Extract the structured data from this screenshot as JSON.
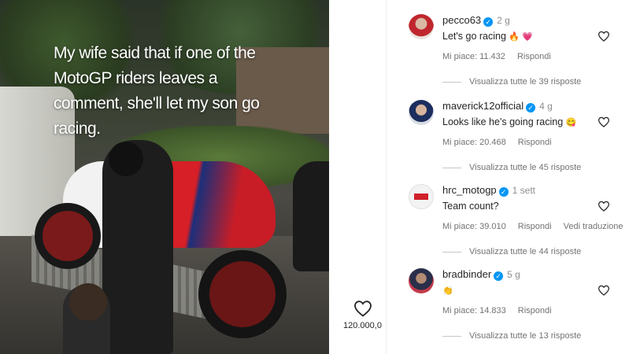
{
  "post": {
    "caption": "My wife said that if one of the MotoGP riders leaves a comment, she'll let my son go racing.",
    "like_count": "120.000,0"
  },
  "comments": [
    {
      "username": "pecco63",
      "time": "2 g",
      "text": "Let's go racing",
      "emoji": "🔥 💗",
      "likes": "Mi piace: 11.432",
      "reply": "Rispondi",
      "translate": "",
      "view_replies": "Visualizza tutte le 39 risposte"
    },
    {
      "username": "maverick12official",
      "time": "4 g",
      "text": "Looks like he's going racing",
      "emoji": "😋",
      "likes": "Mi piace: 20.468",
      "reply": "Rispondi",
      "translate": "",
      "view_replies": "Visualizza tutte le 45 risposte"
    },
    {
      "username": "hrc_motogp",
      "time": "1 sett",
      "text": "Team count?",
      "emoji": "",
      "likes": "Mi piace: 39.010",
      "reply": "Rispondi",
      "translate": "Vedi traduzione",
      "view_replies": "Visualizza tutte le 44 risposte"
    },
    {
      "username": "bradbinder",
      "time": "5 g",
      "text": "",
      "emoji": "👏",
      "likes": "Mi piace: 14.833",
      "reply": "Rispondi",
      "translate": "",
      "view_replies": "Visualizza tutte le 13 risposte"
    }
  ],
  "colors": {
    "verified": "#0095f6",
    "text_primary": "#262626",
    "text_secondary": "#737373"
  },
  "icons": {
    "like": "heart-outline-icon",
    "verified": "verified-badge-icon"
  }
}
